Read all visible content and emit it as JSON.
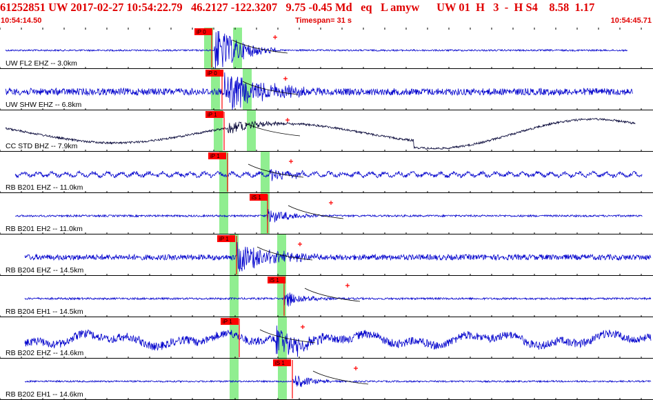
{
  "header": {
    "summary_line": "61252851 UW 2017-02-27 10:54:22.79   46.2127 -122.3207   9.75 -0.45 Md   eq   L amyw      UW 01  H   3  -  H S4    8.58  1.17",
    "start_time": "10:54:14.50",
    "timespan_label": "Timespan=",
    "timespan_value": "31 s",
    "end_time": "10:54:45.71"
  },
  "colors": {
    "header_text": "#e00000",
    "waveform_vertical": "#0000cc",
    "waveform_broadband": "#000033",
    "phase_marker": "#ff0000",
    "pick_window": "#90ee90",
    "grid": "#000000"
  },
  "traces": [
    {
      "label": "UW FL2 EHZ -- 3.0km",
      "color": "#0000cc",
      "picks": [
        {
          "text": "iP 0",
          "type": "P"
        }
      ],
      "windows": 2
    },
    {
      "label": "UW SHW EHZ -- 6.8km",
      "color": "#0000cc",
      "picks": [
        {
          "text": "iP 0",
          "type": "P"
        }
      ],
      "windows": 2
    },
    {
      "label": "CC STD BHZ -- 7.9km",
      "color": "#000033",
      "picks": [
        {
          "text": "iP 1",
          "type": "P"
        }
      ],
      "windows": 2
    },
    {
      "label": "RB B201 EHZ -- 11.0km",
      "color": "#0000cc",
      "picks": [
        {
          "text": "iP 1",
          "type": "P"
        }
      ],
      "windows": 2
    },
    {
      "label": "RB B201 EH2 -- 11.0km",
      "color": "#0000cc",
      "picks": [
        {
          "text": "iS 1",
          "type": "S"
        }
      ],
      "windows": 2
    },
    {
      "label": "RB B204 EHZ -- 14.5km",
      "color": "#0000cc",
      "picks": [
        {
          "text": "iP 1",
          "type": "P"
        }
      ],
      "windows": 2
    },
    {
      "label": "RB B204 EH1 -- 14.5km",
      "color": "#0000cc",
      "picks": [
        {
          "text": "iS 1",
          "type": "S"
        }
      ],
      "windows": 2
    },
    {
      "label": "RB B202 EHZ -- 14.6km",
      "color": "#0000cc",
      "picks": [
        {
          "text": "iP 1",
          "type": "P"
        }
      ],
      "windows": 2
    },
    {
      "label": "RB B202 EH1 -- 14.6km",
      "color": "#0000cc",
      "picks": [
        {
          "text": "iS 1",
          "type": "S"
        }
      ],
      "windows": 2
    }
  ]
}
